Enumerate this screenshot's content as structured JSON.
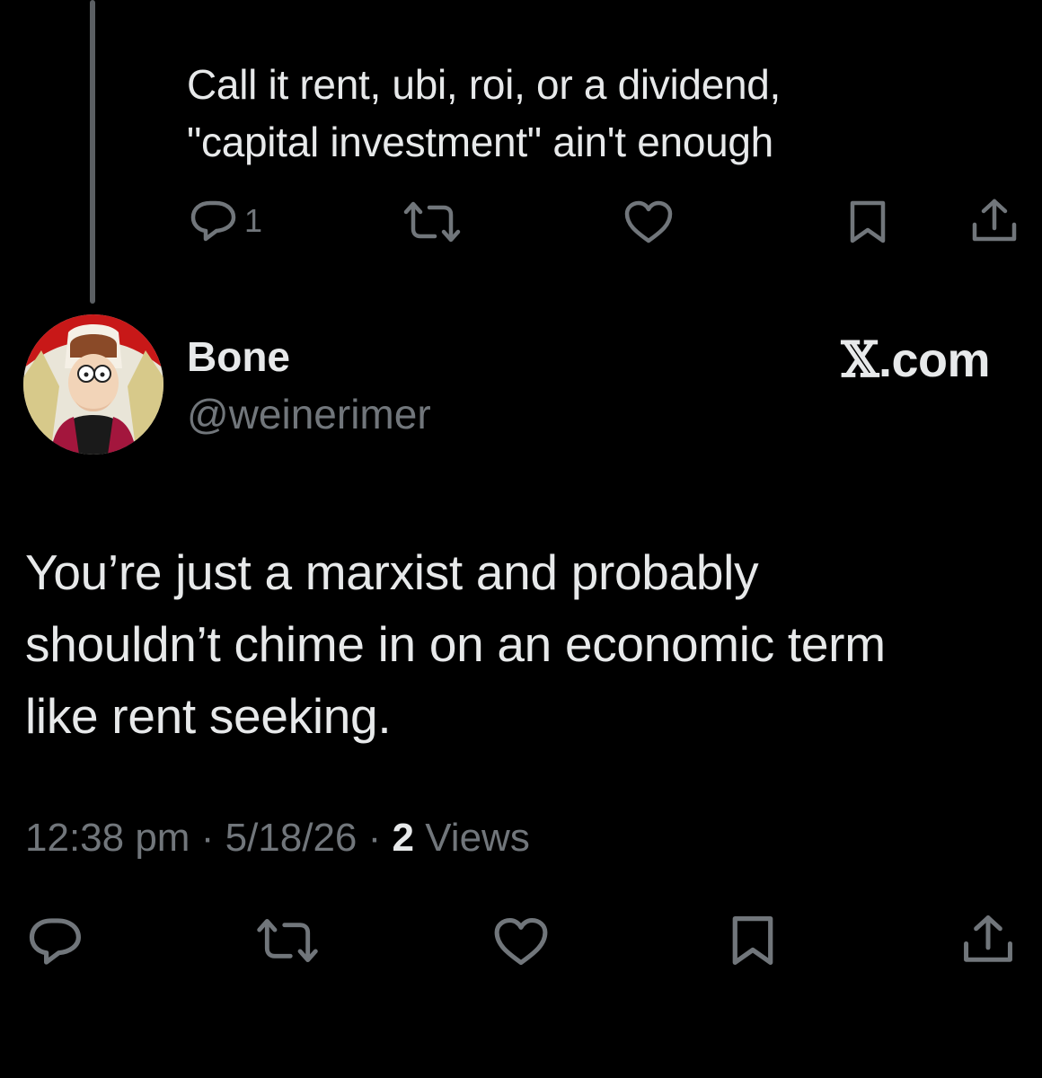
{
  "parent_tweet": {
    "text_line1": "Call it rent, ubi, roi, or a dividend,",
    "text_line2": "\"capital investment\" ain't enough",
    "actions": {
      "reply_icon": "reply-icon",
      "reply_count": "1",
      "retweet_icon": "retweet-icon",
      "like_icon": "heart-icon",
      "bookmark_icon": "bookmark-icon",
      "share_icon": "share-icon"
    }
  },
  "reply_tweet": {
    "display_name": "Bone",
    "handle": "@weinerimer",
    "brand": ".com",
    "brand_glyph": "𝕏",
    "text_line1": "You’re just a marxist and probably",
    "text_line2": "shouldn’t chime in on an economic term",
    "text_line3": "like rent seeking.",
    "time": "12:38 pm",
    "date": "5/18/26",
    "separator": "·",
    "views_count": "2",
    "views_label": "Views"
  },
  "colors": {
    "background": "#000000",
    "text_primary": "#e7e9ea",
    "text_secondary": "#71767b",
    "thread_line": "#5b5f63"
  }
}
